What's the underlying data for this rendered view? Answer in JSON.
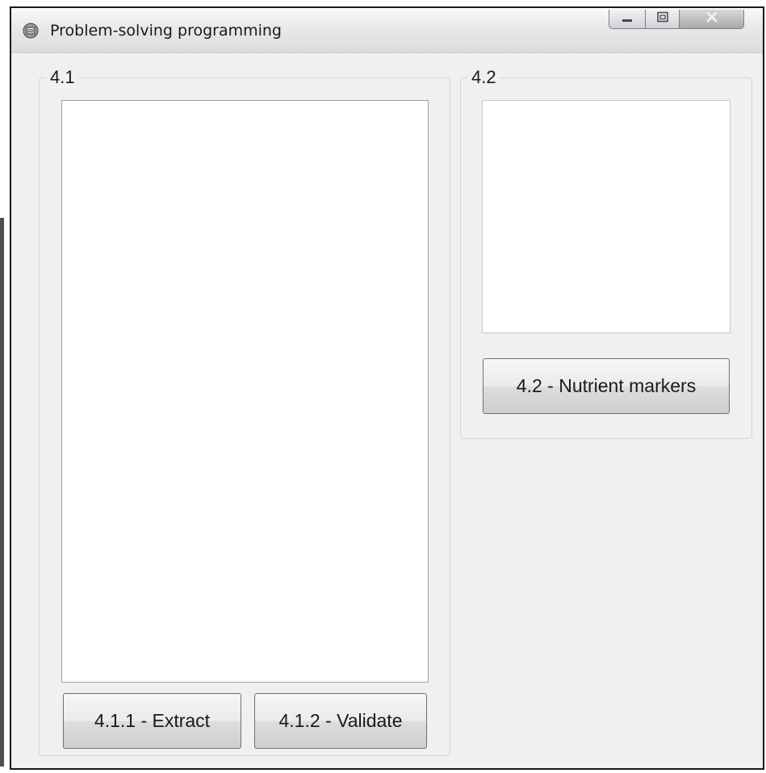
{
  "window": {
    "title": "Problem-solving programming",
    "controls": {
      "minimize": "minimize-icon",
      "maximize": "maximize-icon",
      "close": "close-icon"
    }
  },
  "group_4_1": {
    "label": "4.1",
    "buttons": {
      "extract": "4.1.1 - Extract",
      "validate": "4.1.2 - Validate"
    }
  },
  "group_4_2": {
    "label": "4.2",
    "buttons": {
      "nutrient_markers": "4.2 - Nutrient markers"
    }
  }
}
